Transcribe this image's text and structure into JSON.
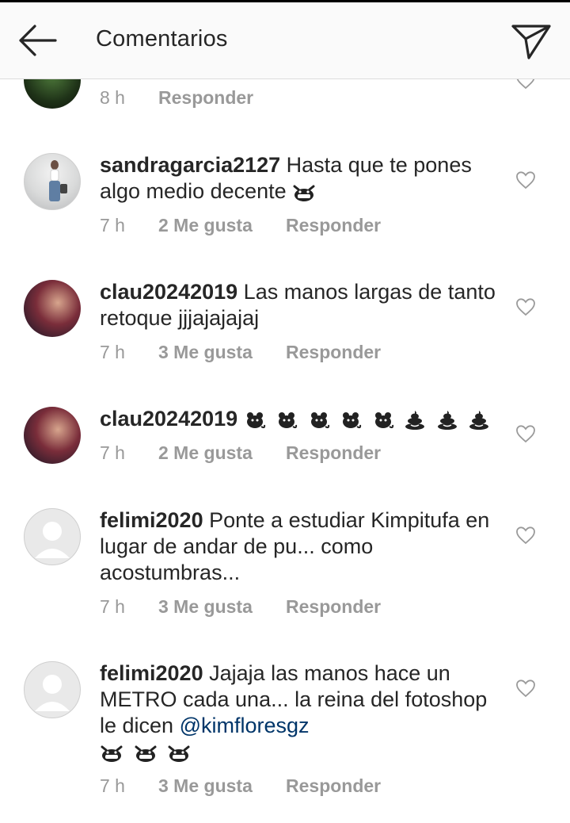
{
  "header": {
    "title": "Comentarios"
  },
  "comments": [
    {
      "username": "",
      "text": "",
      "time": "8 h",
      "likes": "",
      "reply": "Responder"
    },
    {
      "username": "sandragarcia2127",
      "text": "Hasta que te pones algo medio decente",
      "emojis": 1,
      "time": "7 h",
      "likes": "2 Me gusta",
      "reply": "Responder"
    },
    {
      "username": "clau20242019",
      "text": "Las manos largas de tanto retoque jjjajajajaj",
      "time": "7 h",
      "likes": "3 Me gusta",
      "reply": "Responder"
    },
    {
      "username": "clau20242019",
      "text": "",
      "time": "7 h",
      "likes": "2 Me gusta",
      "reply": "Responder"
    },
    {
      "username": "felimi2020",
      "text": "Ponte a estudiar Kimpitufa en lugar de andar de pu... como acostumbras...",
      "time": "7 h",
      "likes": "3 Me gusta",
      "reply": "Responder"
    },
    {
      "username": "felimi2020",
      "text": "Jajaja las manos hace un METRO cada una... la reina del fotoshop le dicen",
      "mention": "@kimfloresgz",
      "time": "7 h",
      "likes": "3 Me gusta",
      "reply": "Responder"
    }
  ],
  "colors": {
    "text": "#262626",
    "meta": "#999999",
    "mention": "#003569",
    "header_bg": "#fafafa"
  }
}
